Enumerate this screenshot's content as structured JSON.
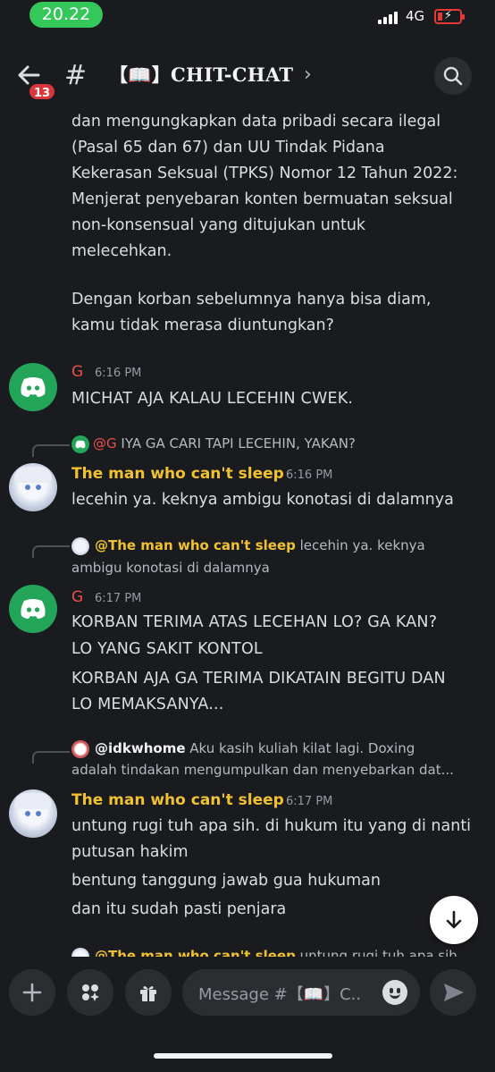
{
  "status_bar": {
    "time": "20.22",
    "network": "4G"
  },
  "header": {
    "badge_count": "13",
    "channel_prefix": "#",
    "channel_name": "【📖】CHIT-CHAT",
    "chevron": "›"
  },
  "messages": {
    "continued_lines": [
      "dan mengungkapkan data pribadi secara ilegal",
      "(Pasal 65 dan 67) dan UU Tindak Pidana",
      "Kekerasan Seksual (TPKS) Nomor 12 Tahun 2022:",
      "Menjerat penyebaran konten bermuatan seksual",
      "non-konsensual yang ditujukan untuk",
      "melecehkan."
    ],
    "continued_lines_2": [
      "Dengan korban sebelumnya hanya bisa diam,",
      "kamu tidak merasa diuntungkan?"
    ],
    "m1": {
      "author": "G",
      "time": "6:16 PM",
      "text": "MICHAT AJA KALAU LECEHIN CWEK."
    },
    "m2": {
      "reply_author": "@G",
      "reply_text": "IYA GA CARI TAPI LECEHIN, YAKAN?",
      "author": "The man who can't sleep",
      "time": "6:16 PM",
      "text": "lecehin ya. keknya ambigu konotasi di dalamnya"
    },
    "m3": {
      "reply_author": "@The man who can't sleep",
      "reply_text": "lecehin ya. keknya",
      "reply_text_2": "ambigu konotasi di dalamnya",
      "author": "G",
      "time": "6:17 PM",
      "lines": [
        "KORBAN TERIMA ATAS LECEHAN LO? GA KAN?",
        "LO YANG SAKIT KONTOL",
        "KORBAN AJA GA TERIMA DIKATAIN BEGITU DAN",
        "LO MEMAKSANYA..."
      ]
    },
    "m4": {
      "reply_author": "@idkwhome",
      "reply_text": "Aku kasih kuliah kilat lagi.  Doxing",
      "reply_text_2": "adalah tindakan mengumpulkan dan menyebarkan dat...",
      "author": "The man who can't sleep",
      "time": "6:17 PM",
      "lines": [
        "untung rugi tuh apa sih. di hukum itu yang di nanti",
        "putusan hakim",
        "bentung tanggung jawab gua hukuman",
        "dan itu sudah pasti penjara"
      ]
    },
    "m5": {
      "reply_author": "@The man who can't sleep",
      "reply_text": "untung rugi tuh apa sih"
    }
  },
  "composer": {
    "placeholder": "Message #【📖】C.."
  },
  "colors": {
    "background": "#1a1b1f",
    "accent_green": "#23a55a",
    "author_red": "#e8504a",
    "author_gold": "#f0c232",
    "badge_red": "#da373c"
  }
}
